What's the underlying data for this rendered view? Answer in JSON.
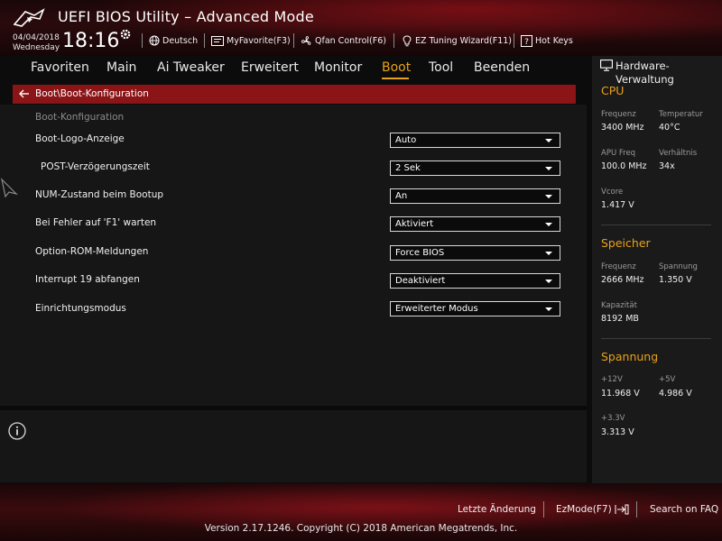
{
  "header": {
    "title": "UEFI BIOS Utility – Advanced Mode",
    "date": "04/04/2018",
    "weekday": "Wednesday",
    "time": "18:16",
    "tools": {
      "language": "Deutsch",
      "myfavorite": "MyFavorite(F3)",
      "qfan": "Qfan Control(F6)",
      "ez_tuning": "EZ Tuning Wizard(F11)",
      "hotkeys": "Hot Keys"
    }
  },
  "nav": {
    "tabs": [
      {
        "label": "Favoriten"
      },
      {
        "label": "Main"
      },
      {
        "label": "Ai Tweaker"
      },
      {
        "label": "Erweitert"
      },
      {
        "label": "Monitor"
      },
      {
        "label": "Boot",
        "active": true
      },
      {
        "label": "Tool"
      },
      {
        "label": "Beenden"
      }
    ]
  },
  "breadcrumb": "Boot\\Boot-Konfiguration",
  "main": {
    "section_heading": "Boot-Konfiguration",
    "settings": [
      {
        "label": "Boot-Logo-Anzeige",
        "value": "Auto"
      },
      {
        "label": "POST-Verzögerungszeit",
        "value": "2 Sek"
      },
      {
        "label": "NUM-Zustand beim Bootup",
        "value": "An"
      },
      {
        "label": "Bei Fehler auf 'F1' warten",
        "value": "Aktiviert"
      },
      {
        "label": "Option-ROM-Meldungen",
        "value": "Force BIOS"
      },
      {
        "label": "Interrupt 19 abfangen",
        "value": "Deaktiviert"
      },
      {
        "label": "Einrichtungsmodus",
        "value": "Erweiterter Modus"
      }
    ]
  },
  "hardware_monitor": {
    "title": "Hardware-Verwaltung",
    "cpu": {
      "heading": "CPU",
      "freq_label": "Frequenz",
      "freq_value": "3400 MHz",
      "temp_label": "Temperatur",
      "temp_value": "40°C",
      "apu_label": "APU Freq",
      "apu_value": "100.0 MHz",
      "ratio_label": "Verhältnis",
      "ratio_value": "34x",
      "vcore_label": "Vcore",
      "vcore_value": "1.417 V"
    },
    "memory": {
      "heading": "Speicher",
      "freq_label": "Frequenz",
      "freq_value": "2666 MHz",
      "volt_label": "Spannung",
      "volt_value": "1.350 V",
      "cap_label": "Kapazität",
      "cap_value": "8192 MB"
    },
    "voltage": {
      "heading": "Spannung",
      "v12_label": "+12V",
      "v12_value": "11.968 V",
      "v5_label": "+5V",
      "v5_value": "4.986 V",
      "v33_label": "+3.3V",
      "v33_value": "3.313 V"
    }
  },
  "footer": {
    "last_change": "Letzte Änderung",
    "ezmode": "EzMode(F7)",
    "search_faq": "Search on FAQ",
    "version": "Version 2.17.1246. Copyright (C) 2018 American Megatrends, Inc."
  },
  "colors": {
    "accent": "#e8a21a",
    "breadcrumb_bg": "#8a1416",
    "panel_bg": "#161616"
  }
}
